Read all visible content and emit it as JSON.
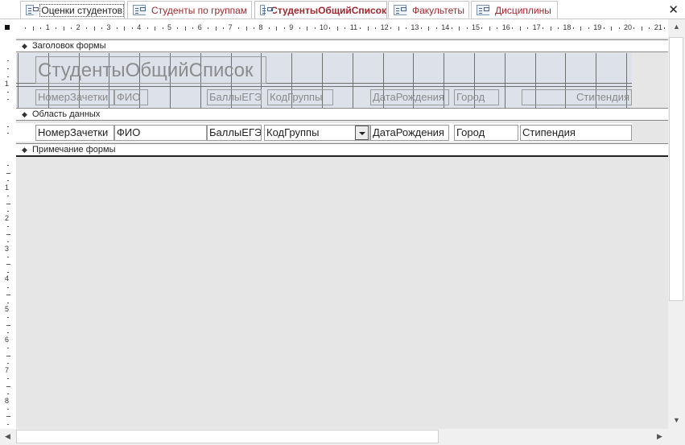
{
  "tabs": [
    {
      "label": "Оценки студентов",
      "icon": "form-icon",
      "active": false,
      "focus": true
    },
    {
      "label": "Студенты по группам",
      "icon": "form-icon",
      "active": false,
      "focus": false
    },
    {
      "label": "СтудентыОбщийСписок",
      "icon": "form-icon",
      "active": true,
      "focus": false
    },
    {
      "label": "Факультеты",
      "icon": "form-icon",
      "active": false,
      "focus": false
    },
    {
      "label": "Дисциплины",
      "icon": "form-icon",
      "active": false,
      "focus": false
    }
  ],
  "close_glyph": "✕",
  "ruler": {
    "h_numbers": [
      "1",
      "2",
      "3",
      "4",
      "5",
      "6",
      "7",
      "8",
      "9",
      "10",
      "11",
      "12",
      "13",
      "14",
      "15",
      "16",
      "17",
      "18",
      "19",
      "20",
      "21"
    ],
    "v_numbers": [
      "1",
      "1",
      "2",
      "3",
      "4",
      "5",
      "6",
      "7",
      "8"
    ]
  },
  "sections": {
    "header": "Заголовок формы",
    "detail": "Область данных",
    "footer": "Примечание формы"
  },
  "form_header": {
    "title": "СтудентыОбщийСписок",
    "labels": [
      "НомерЗачетки",
      "ФИО",
      "БаллыЕГЭ",
      "КодГруппы",
      "ДатаРождения",
      "Город",
      "Стипендия"
    ]
  },
  "detail": {
    "fields": [
      "НомерЗачетки",
      "ФИО",
      "БаллыЕГЭ",
      "КодГруппы",
      "ДатаРождения",
      "Город",
      "Стипендия"
    ]
  },
  "colors": {
    "tab_text": "#a4262c",
    "header_bg": "#dde1ea",
    "canvas_bg": "#e6e6e6"
  }
}
